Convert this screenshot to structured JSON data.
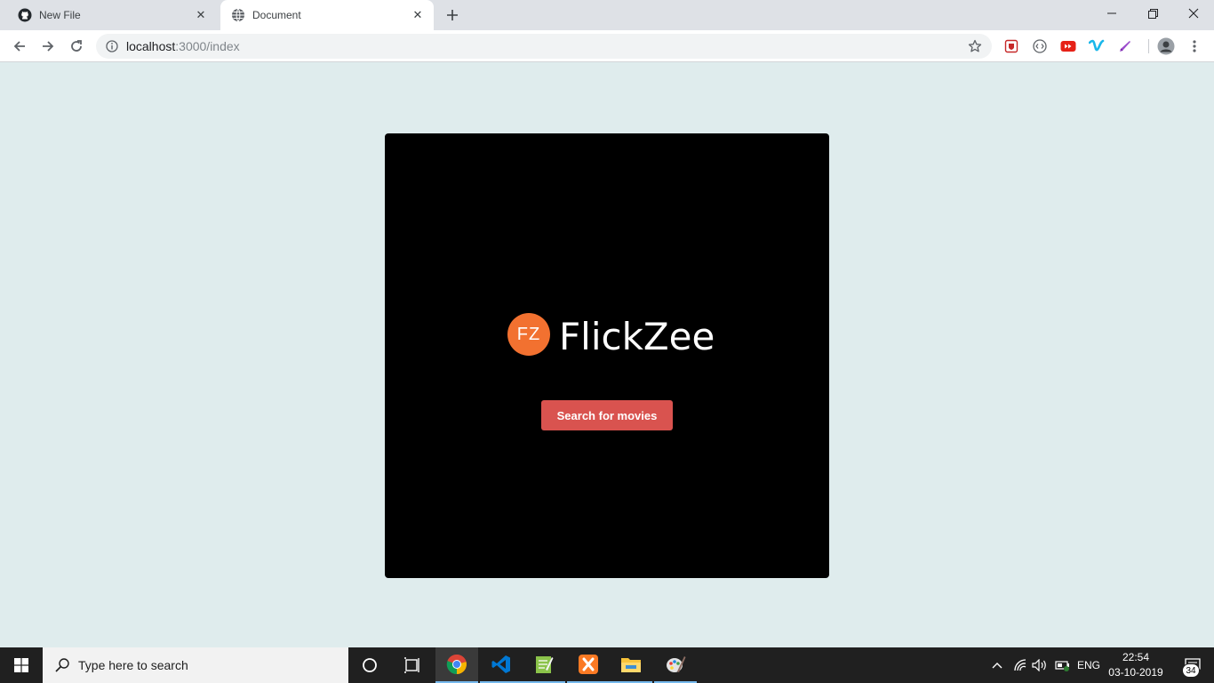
{
  "browser": {
    "tabs": [
      {
        "title": "New File",
        "favicon": "github-icon",
        "active": false
      },
      {
        "title": "Document",
        "favicon": "globe-icon",
        "active": true
      }
    ],
    "url_host": "localhost",
    "url_path": ":3000/index",
    "extensions": [
      "shield-extension-icon",
      "code-extension-icon",
      "youtube-extension-icon",
      "vimeo-extension-icon",
      "pen-extension-icon"
    ]
  },
  "page": {
    "logo_badge": "FZ",
    "logo_text": "FlickZee",
    "search_button_label": "Search for movies",
    "colors": {
      "background": "#dfeced",
      "card": "#000000",
      "badge": "#f27130",
      "button": "#d9534f"
    }
  },
  "taskbar": {
    "search_placeholder": "Type here to search",
    "apps": [
      "cortana-icon",
      "task-view-icon",
      "chrome-icon",
      "vscode-icon",
      "notepad-plus-icon",
      "xampp-icon",
      "file-explorer-icon",
      "paint-icon"
    ],
    "language": "ENG",
    "time": "22:54",
    "date": "03-10-2019",
    "notification_count": "34"
  }
}
